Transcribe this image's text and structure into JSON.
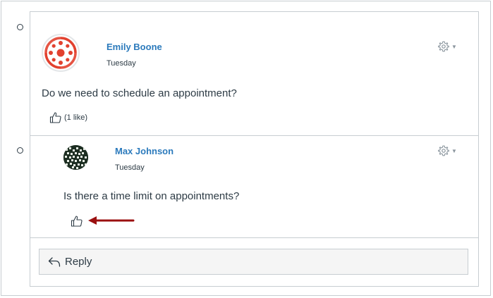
{
  "entries": [
    {
      "author": "Emily Boone",
      "date": "Tuesday",
      "message": "Do we need to schedule an appointment?",
      "like_count": "(1 like)",
      "avatar": "canvas-logo-avatar"
    },
    {
      "author": "Max Johnson",
      "date": "Tuesday",
      "message": "Is there a time limit on appointments?",
      "avatar": "pattern-avatar"
    }
  ],
  "reply": {
    "label": "Reply"
  },
  "colors": {
    "author_link": "#2b7abc",
    "border": "#c7cdd1",
    "annotation_arrow": "#9b1010",
    "logo": "#e2412f"
  },
  "icons": {
    "like": "thumbs-up-icon",
    "settings": "gear-icon",
    "reply": "reply-arrow-icon",
    "caret": "caret-down-icon"
  }
}
